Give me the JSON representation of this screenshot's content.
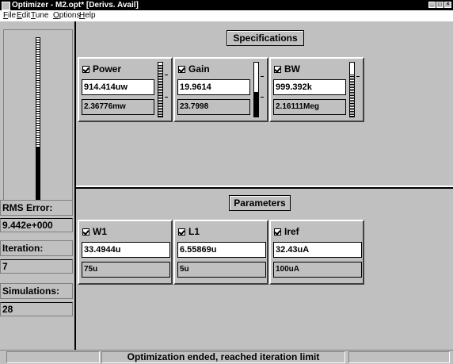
{
  "window": {
    "title": "Optimizer - M2.opt*  [Derivs. Avail]"
  },
  "menu": {
    "items": [
      "File",
      "Edit",
      "Tune",
      "Options",
      "Help"
    ]
  },
  "left_panel": {
    "progress": 0.36,
    "rms_label": "RMS Error:",
    "rms_value": "9.442e+000",
    "iteration_label": "Iteration:",
    "iteration_value": "7",
    "simulations_label": "Simulations:",
    "simulations_value": "28"
  },
  "specifications": {
    "title": "Specifications",
    "items": [
      {
        "name": "Power",
        "checked": true,
        "value": "914.414uw",
        "target": "2.36776mw",
        "gauge_level": 0.95
      },
      {
        "name": "Gain",
        "checked": true,
        "value": "19.9614",
        "target": "23.7998",
        "gauge_level": 0.45
      },
      {
        "name": "BW",
        "checked": true,
        "value": "999.392k",
        "target": "2.16111Meg",
        "gauge_level": 0.8
      }
    ]
  },
  "parameters": {
    "title": "Parameters",
    "items": [
      {
        "name": "W1",
        "checked": true,
        "value": "33.4944u",
        "limit": "75u"
      },
      {
        "name": "L1",
        "checked": true,
        "value": "6.55869u",
        "limit": "5u"
      },
      {
        "name": "Iref",
        "checked": true,
        "value": "32.43uA",
        "limit": "100uA"
      }
    ]
  },
  "status": {
    "message": "Optimization ended, reached iteration limit"
  }
}
